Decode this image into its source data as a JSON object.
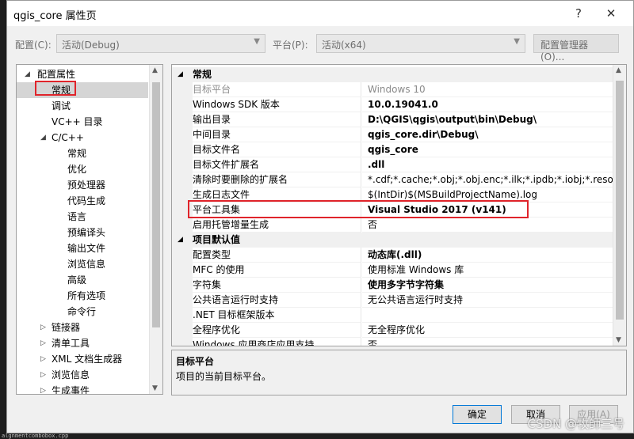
{
  "window": {
    "title": "qgis_core 属性页",
    "help_btn": "?",
    "close_btn": "✕"
  },
  "config_bar": {
    "config_label": "配置(C):",
    "config_value": "活动(Debug)",
    "platform_label": "平台(P):",
    "platform_value": "活动(x64)",
    "manager_button": "配置管理器(O)..."
  },
  "tree": {
    "items": [
      {
        "label": "配置属性",
        "level": 0,
        "expander": "down"
      },
      {
        "label": "常规",
        "level": 1,
        "selected": true
      },
      {
        "label": "调试",
        "level": 1
      },
      {
        "label": "VC++ 目录",
        "level": 1
      },
      {
        "label": "C/C++",
        "level": 1,
        "expander": "down"
      },
      {
        "label": "常规",
        "level": 2
      },
      {
        "label": "优化",
        "level": 2
      },
      {
        "label": "预处理器",
        "level": 2
      },
      {
        "label": "代码生成",
        "level": 2
      },
      {
        "label": "语言",
        "level": 2
      },
      {
        "label": "预编译头",
        "level": 2
      },
      {
        "label": "输出文件",
        "level": 2
      },
      {
        "label": "浏览信息",
        "level": 2
      },
      {
        "label": "高级",
        "level": 2
      },
      {
        "label": "所有选项",
        "level": 2
      },
      {
        "label": "命令行",
        "level": 2
      },
      {
        "label": "链接器",
        "level": 1,
        "expander": "right"
      },
      {
        "label": "清单工具",
        "level": 1,
        "expander": "right"
      },
      {
        "label": "XML 文档生成器",
        "level": 1,
        "expander": "right"
      },
      {
        "label": "浏览信息",
        "level": 1,
        "expander": "right"
      },
      {
        "label": "生成事件",
        "level": 1,
        "expander": "right"
      }
    ]
  },
  "grid": {
    "sections": [
      {
        "name": "常规",
        "props": [
          {
            "name": "目标平台",
            "value": "Windows 10",
            "dim": true
          },
          {
            "name": "Windows SDK 版本",
            "value": "10.0.19041.0",
            "bold": true
          },
          {
            "name": "输出目录",
            "value": "D:\\QGIS\\qgis\\output\\bin\\Debug\\",
            "bold": true
          },
          {
            "name": "中间目录",
            "value": "qgis_core.dir\\Debug\\",
            "bold": true
          },
          {
            "name": "目标文件名",
            "value": "qgis_core",
            "bold": true
          },
          {
            "name": "目标文件扩展名",
            "value": ".dll",
            "bold": true
          },
          {
            "name": "清除时要删除的扩展名",
            "value": "*.cdf;*.cache;*.obj;*.obj.enc;*.ilk;*.ipdb;*.iobj;*.resource"
          },
          {
            "name": "生成日志文件",
            "value": "$(IntDir)$(MSBuildProjectName).log"
          },
          {
            "name": "平台工具集",
            "value": "Visual Studio 2017 (v141)",
            "bold": true
          },
          {
            "name": "启用托管增量生成",
            "value": "否"
          }
        ]
      },
      {
        "name": "项目默认值",
        "props": [
          {
            "name": "配置类型",
            "value": "动态库(.dll)",
            "bold": true
          },
          {
            "name": "MFC 的使用",
            "value": "使用标准 Windows 库"
          },
          {
            "name": "字符集",
            "value": "使用多字节字符集",
            "bold": true
          },
          {
            "name": "公共语言运行时支持",
            "value": "无公共语言运行时支持"
          },
          {
            "name": ".NET 目标框架版本",
            "value": ""
          },
          {
            "name": "全程序优化",
            "value": "无全程序优化"
          },
          {
            "name": "Windows 应用商店应用支持",
            "value": "否"
          }
        ]
      }
    ]
  },
  "description": {
    "title": "目标平台",
    "text": "项目的当前目标平台。"
  },
  "buttons": {
    "ok": "确定",
    "cancel": "取消",
    "apply": "应用(A)"
  },
  "background": {
    "bottom_text": "algnmentcombobox.cpp"
  },
  "watermark": "CSDN @牧師三号",
  "colors": {
    "highlight_red": "#e0242b",
    "selected_bg": "#d5d5d5"
  }
}
